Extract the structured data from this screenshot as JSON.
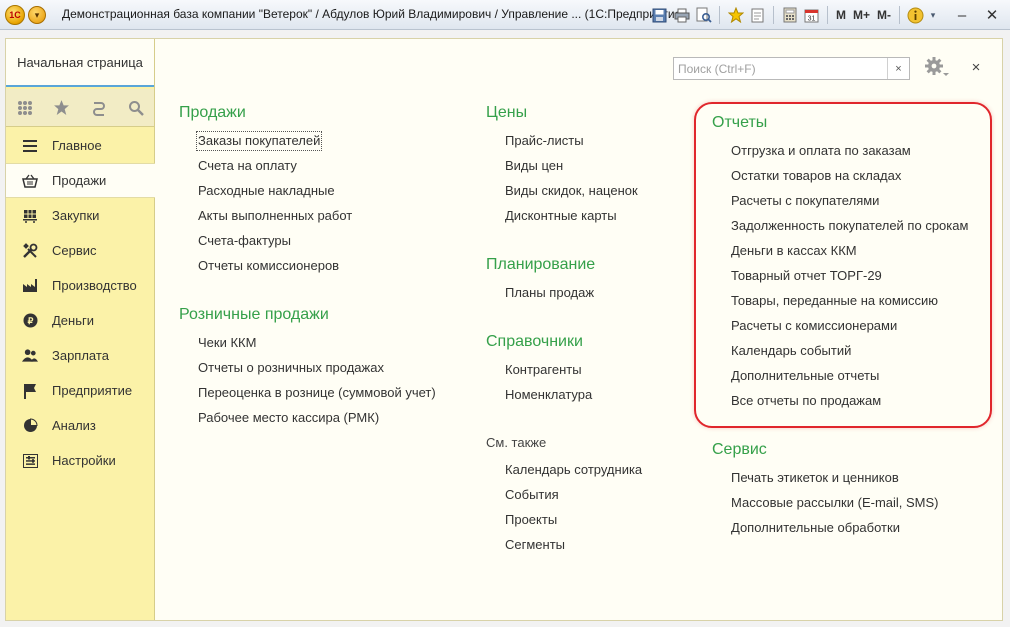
{
  "titlebar": {
    "logo": "1C",
    "title": "Демонстрационная база компании \"Ветерок\" / Абдулов Юрий Владимирович / Управление ...  (1С:Предприятие)",
    "m_buttons": [
      "M",
      "M+",
      "M-"
    ],
    "icons": [
      "save-icon",
      "print-icon",
      "preview-icon",
      "favorites-add-icon",
      "link-icon",
      "calculator-icon",
      "calendar-icon",
      "info-icon"
    ]
  },
  "home_tab": {
    "label": "Начальная страница"
  },
  "quick_icons": [
    "apps-grid-icon",
    "star-icon",
    "history-icon",
    "search-icon"
  ],
  "sections": [
    {
      "label": "Главное",
      "icon": "menu-lines-icon"
    },
    {
      "label": "Продажи",
      "icon": "basket-icon",
      "active": true
    },
    {
      "label": "Закупки",
      "icon": "cart-icon"
    },
    {
      "label": "Сервис",
      "icon": "tools-icon"
    },
    {
      "label": "Производство",
      "icon": "factory-icon"
    },
    {
      "label": "Деньги",
      "icon": "coin-icon"
    },
    {
      "label": "Зарплата",
      "icon": "people-icon"
    },
    {
      "label": "Предприятие",
      "icon": "flag-icon"
    },
    {
      "label": "Анализ",
      "icon": "pie-chart-icon"
    },
    {
      "label": "Настройки",
      "icon": "settings-list-icon"
    }
  ],
  "search": {
    "placeholder": "Поиск (Ctrl+F)",
    "clear": "×"
  },
  "close_label": "×",
  "columns": {
    "col1": [
      {
        "title": "Продажи",
        "items": [
          "Заказы покупателей",
          "Счета на оплату",
          "Расходные накладные",
          "Акты выполненных работ",
          "Счета-фактуры",
          "Отчеты комиссионеров"
        ]
      },
      {
        "title": "Розничные продажи",
        "items": [
          "Чеки ККМ",
          "Отчеты о розничных продажах",
          "Переоценка в рознице (суммовой учет)",
          "Рабочее место кассира (РМК)"
        ]
      }
    ],
    "col2": [
      {
        "title": "Цены",
        "items": [
          "Прайс-листы",
          "Виды цен",
          "Виды скидок, наценок",
          "Дисконтные карты"
        ]
      },
      {
        "title": "Планирование",
        "items": [
          "Планы продаж"
        ]
      },
      {
        "title": "Справочники",
        "items": [
          "Контрагенты",
          "Номенклатура"
        ]
      },
      {
        "subtitle": "См. также",
        "items": [
          "Календарь сотрудника",
          "События",
          "Проекты",
          "Сегменты"
        ]
      }
    ],
    "col3": [
      {
        "title": "Отчеты",
        "items": [
          "Отгрузка и оплата по заказам",
          "Остатки товаров на складах",
          "Расчеты с покупателями",
          "Задолженность покупателей по срокам",
          "Деньги в кассах ККМ",
          "Товарный отчет ТОРГ-29",
          "Товары, переданные на комиссию",
          "Расчеты с комиссионерами",
          "Календарь событий",
          "Дополнительные отчеты",
          "Все отчеты по продажам"
        ]
      },
      {
        "title": "Сервис",
        "items": [
          "Печать этикеток и ценников",
          "Массовые рассылки (E-mail, SMS)",
          "Дополнительные обработки"
        ]
      }
    ]
  },
  "colors": {
    "accent_green": "#35a04a",
    "panel_yellow": "#fbf2a8",
    "highlight_red": "#e0262c"
  }
}
